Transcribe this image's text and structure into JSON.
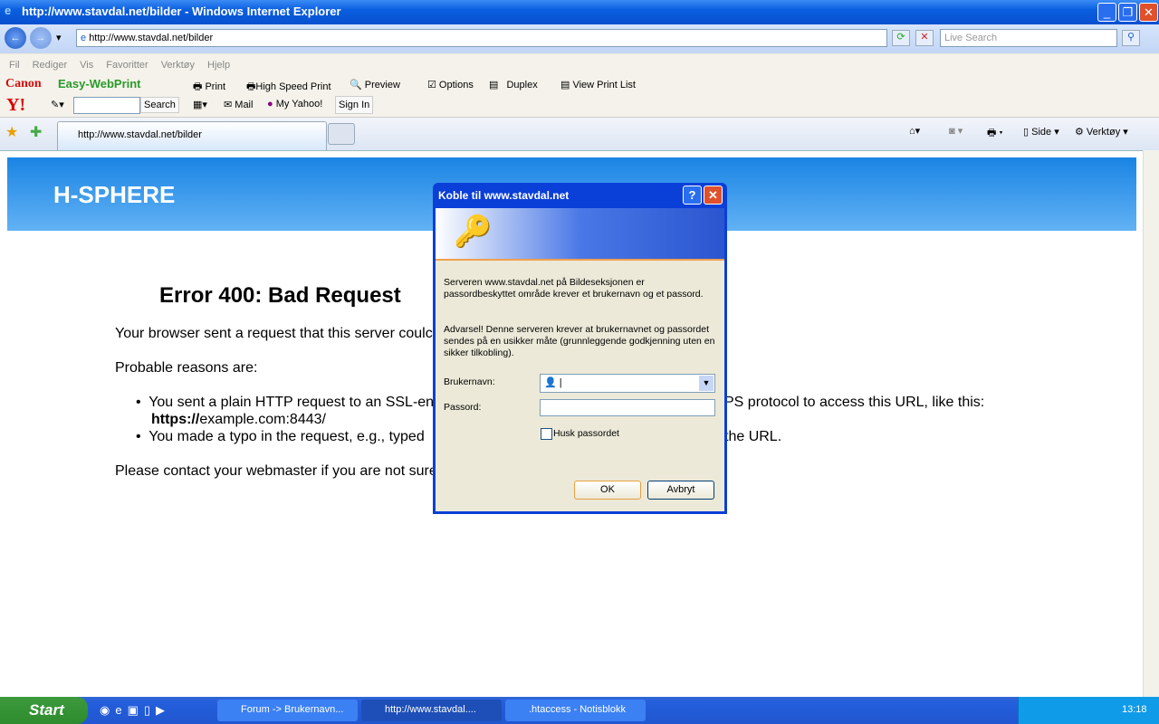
{
  "window": {
    "title": "http://www.stavdal.net/bilder - Windows Internet Explorer"
  },
  "address": {
    "url": "http://www.stavdal.net/bilder",
    "search_placeholder": "Live Search"
  },
  "menu": [
    "Fil",
    "Rediger",
    "Vis",
    "Favoritter",
    "Verktøy",
    "Hjelp"
  ],
  "canon": {
    "brand": "Canon",
    "product": "Easy-WebPrint",
    "print": "Print",
    "high_speed": "High Speed Print",
    "preview": "Preview",
    "options": "Options",
    "duplex": "Duplex",
    "view_list": "View Print List"
  },
  "yahoo": {
    "logo": "Y!",
    "search": "Search",
    "mail": "Mail",
    "my_yahoo": "My Yahoo!",
    "sign_in": "Sign In"
  },
  "tab": {
    "label": "http://www.stavdal.net/bilder"
  },
  "cmdbar": {
    "side": "Side",
    "verktoy": "Verktøy"
  },
  "page": {
    "banner": "H-SPHERE",
    "heading": "Error 400: Bad Request",
    "line1": "Your browser sent a request that this server coulc",
    "line2": "Probable reasons are:",
    "b1_left": "You sent a plain HTTP request to an SSL-en",
    "b1_right": "PS protocol to access this URL, like this:",
    "b1_url_bold": "https://",
    "b1_url_rest": "example.com:8443/",
    "b2_left": "You made a typo in the request, e.g., typed",
    "b2_right": "the URL.",
    "line3": "Please contact your webmaster if you are not sure"
  },
  "dialog": {
    "title": "Koble til www.stavdal.net",
    "message": "Serveren www.stavdal.net på Bildeseksjonen er passordbeskyttet område krever et brukernavn og et passord.",
    "warning": "Advarsel!  Denne serveren krever at brukernavnet og passordet sendes på en usikker måte (grunnleggende godkjenning uten en sikker tilkobling).",
    "username_label": "Brukernavn:",
    "username_value": "",
    "password_label": "Passord:",
    "password_value": "",
    "remember_label": "Husk passordet",
    "remember_checked": false,
    "ok": "OK",
    "cancel": "Avbryt"
  },
  "taskbar": {
    "start": "Start",
    "tasks": [
      "Forum -> Brukernavn...",
      "http://www.stavdal....",
      ".htaccess - Notisblokk"
    ],
    "clock": "13:18"
  }
}
